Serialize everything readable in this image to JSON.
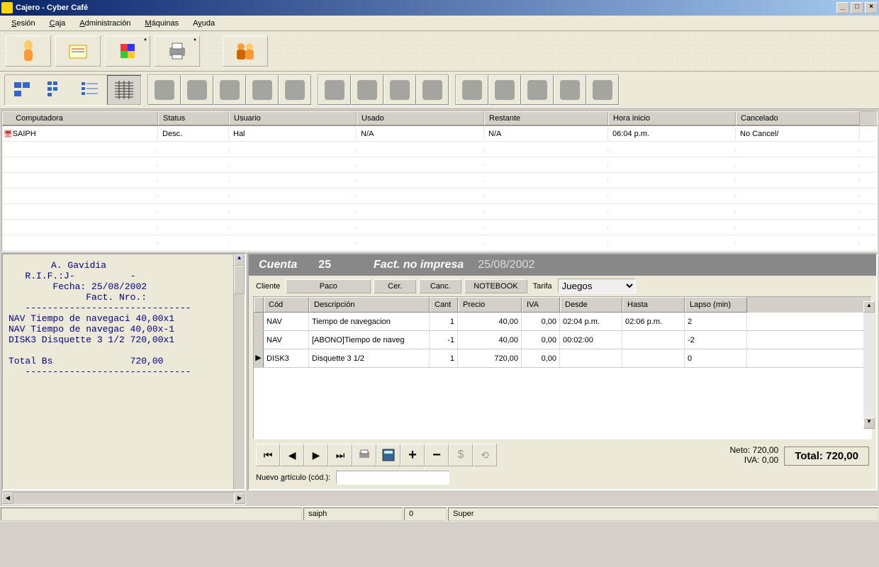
{
  "window": {
    "title": "Cajero - Cyber Café"
  },
  "menu": {
    "sesion": "Sesión",
    "caja": "Caja",
    "admin": "Administración",
    "maquinas": "Máquinas",
    "ayuda": "Ayuda"
  },
  "grid": {
    "headers": {
      "computadora": "Computadora",
      "status": "Status",
      "usuario": "Usuario",
      "usado": "Usado",
      "restante": "Restante",
      "hora_inicio": "Hora inicio",
      "cancelado": "Cancelado"
    },
    "rows": [
      {
        "computadora": "SAIPH",
        "status": "Desc.",
        "usuario": "Hal",
        "usado": "N/A",
        "restante": "N/A",
        "hora_inicio": "06:04 p.m.",
        "cancelado": "No Cancel/"
      }
    ]
  },
  "receipt": {
    "name": "A. Gavidia",
    "rif": "R.I.F.:J-          -",
    "fecha": "Fecha: 25/08/2002",
    "fact": "Fact. Nro.:",
    "divider": "------------------------------",
    "l1": "NAV Tiempo de navegaci 40,00x1",
    "l2": "NAV Tiempo de navegac 40,00x-1",
    "l3": "DISK3 Disquette 3 1/2 720,00x1",
    "total_lbl": "Total Bs",
    "total_val": "720,00"
  },
  "account": {
    "title": "Cuenta",
    "number": "25",
    "status": "Fact. no impresa",
    "date": "25/08/2002",
    "cliente_lbl": "Cliente",
    "cliente_val": "Paco",
    "cer": "Cer.",
    "canc": "Canc.",
    "notebook": "NOTEBOOK",
    "tarifa_lbl": "Tarifa",
    "tarifa_val": "Juegos",
    "headers": {
      "cod": "Cód",
      "descripcion": "Descripción",
      "cant": "Cant",
      "precio": "Precio",
      "iva": "IVA",
      "desde": "Desde",
      "hasta": "Hasta",
      "lapso": "Lapso (min)"
    },
    "rows": [
      {
        "cod": "NAV",
        "desc": "Tiempo de navegacion",
        "cant": "1",
        "precio": "40,00",
        "iva": "0,00",
        "desde": "02:04 p.m.",
        "hasta": "02:06 p.m.",
        "lapso": "2"
      },
      {
        "cod": "NAV",
        "desc": "[ABONO]Tiempo de naveg",
        "cant": "-1",
        "precio": "40,00",
        "iva": "0,00",
        "desde": "00:02:00",
        "hasta": "",
        "lapso": "-2"
      },
      {
        "cod": "DISK3",
        "desc": "Disquette 3 1/2",
        "cant": "1",
        "precio": "720,00",
        "iva": "0,00",
        "desde": "",
        "hasta": "",
        "lapso": "0"
      }
    ],
    "neto_lbl": "Neto:",
    "neto_val": "720,00",
    "iva_lbl": "IVA:",
    "iva_val": "0,00",
    "total_lbl": "Total:",
    "total_val": "720,00",
    "newart_lbl": "Nuevo artículo (cód.):"
  },
  "statusbar": {
    "p2": "saiph",
    "p3": "0",
    "p4": "Super"
  }
}
